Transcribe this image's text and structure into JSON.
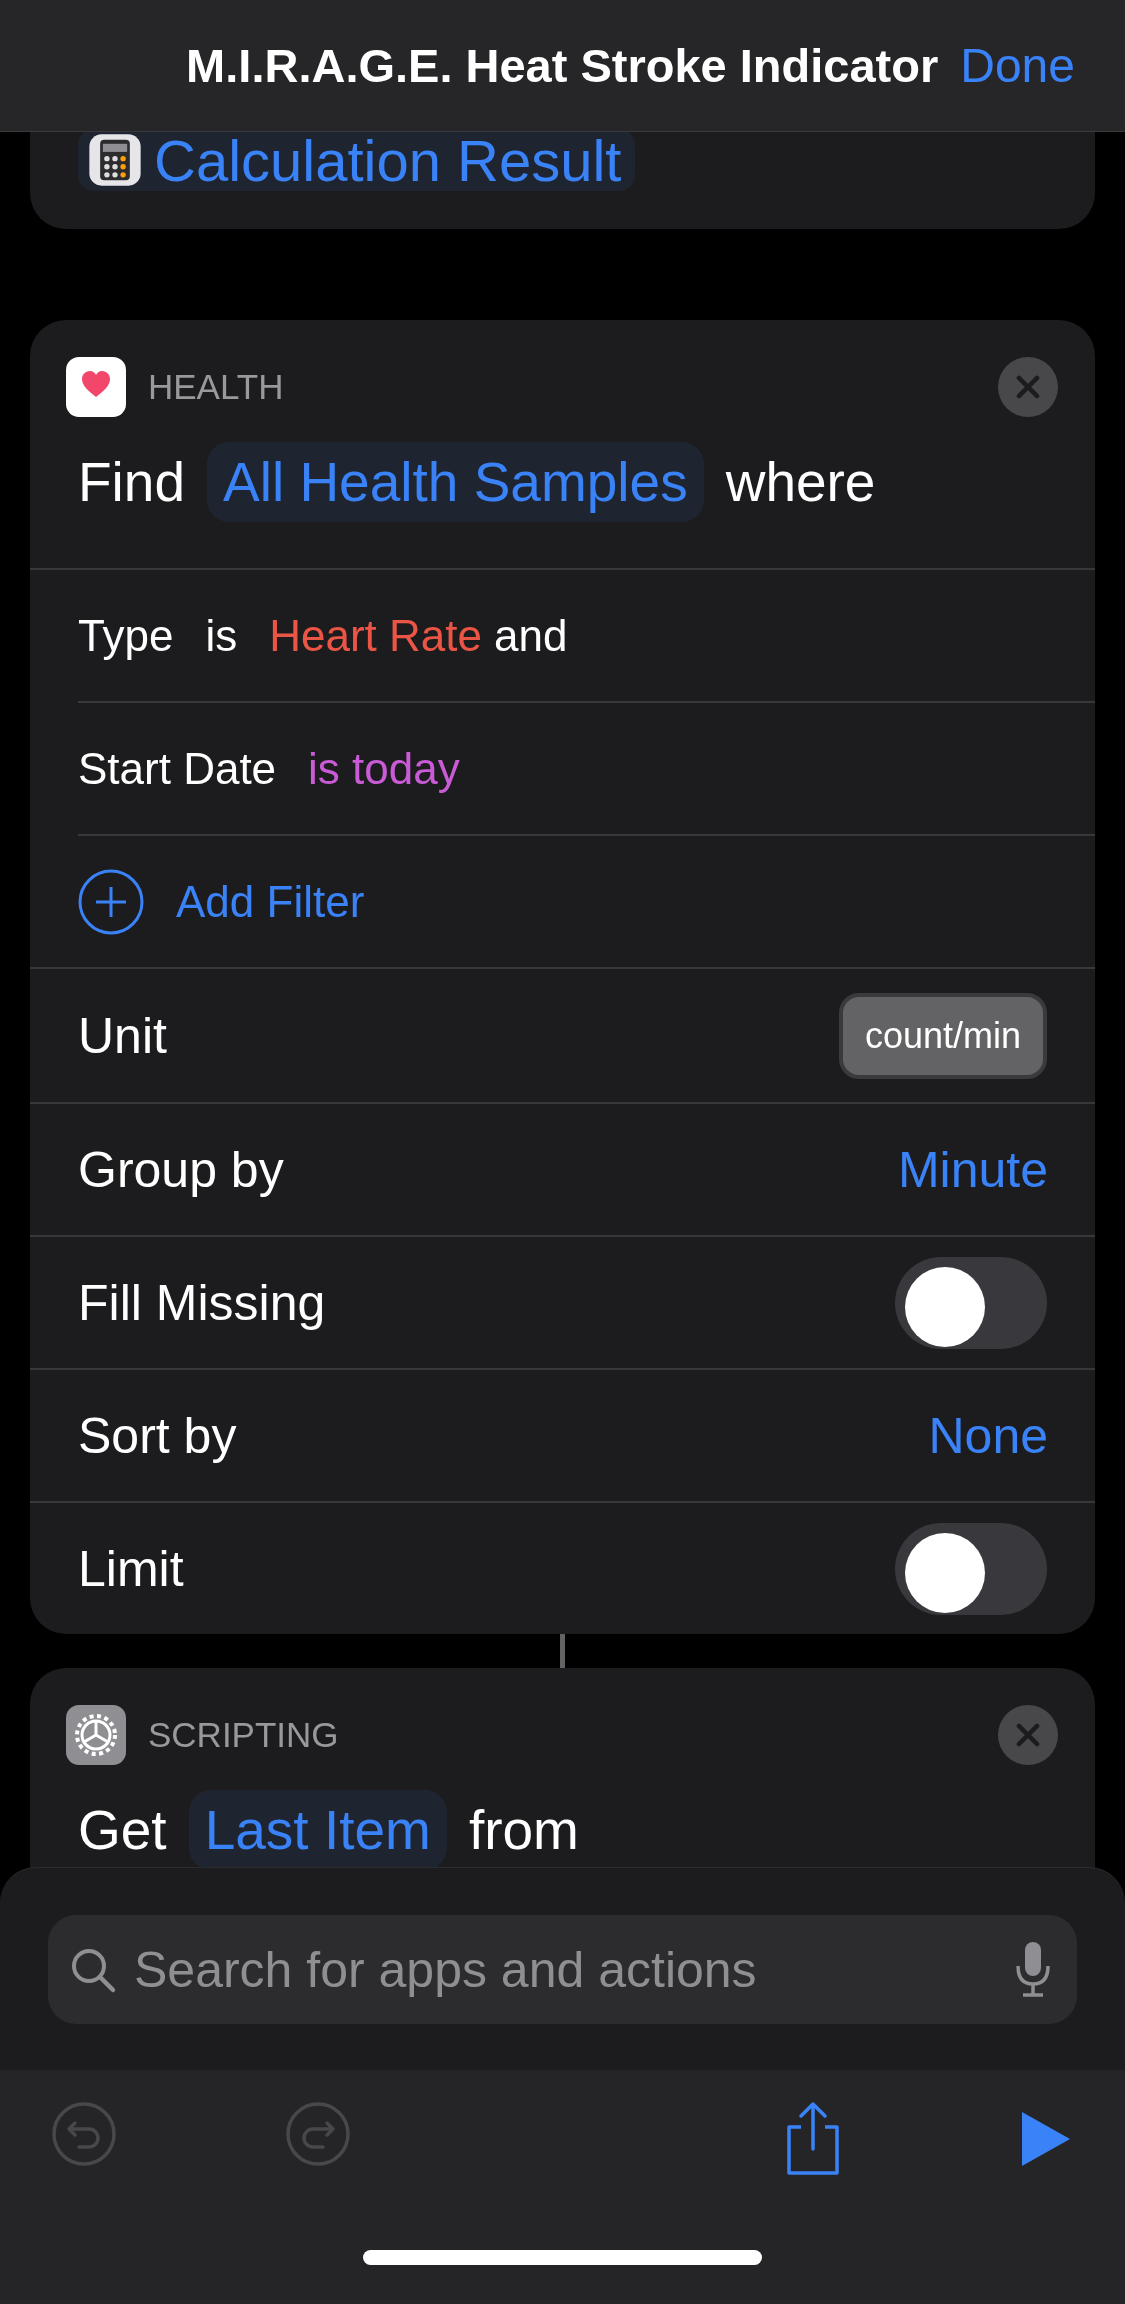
{
  "header": {
    "title": "M.I.R.A.G.E. Heat Stroke Indicator",
    "done": "Done"
  },
  "previous_action": {
    "variable": "Calculation Result"
  },
  "health_action": {
    "category": "HEALTH",
    "verb": "Find",
    "parameter": "All Health Samples",
    "suffix": "where",
    "rows": [
      {
        "kind": "filter",
        "parts": [
          {
            "text": "Type"
          },
          {
            "text": "is"
          },
          {
            "text": "Heart Rate",
            "color": "#eb5545"
          },
          {
            "text": "and"
          }
        ]
      },
      {
        "kind": "filter",
        "parts": [
          {
            "text": "Start Date"
          },
          {
            "text": "is today",
            "color": "#c95bd6"
          }
        ]
      },
      {
        "kind": "add",
        "label": "Add Filter"
      },
      {
        "kind": "chip",
        "label": "Unit",
        "value": "count/min"
      },
      {
        "kind": "link",
        "label": "Group by",
        "value": "Minute"
      },
      {
        "kind": "toggle",
        "label": "Fill Missing",
        "on": false
      },
      {
        "kind": "link",
        "label": "Sort by",
        "value": "None"
      },
      {
        "kind": "toggle",
        "label": "Limit",
        "on": false
      }
    ]
  },
  "scripting_action": {
    "category": "SCRIPTING",
    "verb": "Get",
    "parameter": "Last Item",
    "suffix": "from"
  },
  "search": {
    "placeholder": "Search for apps and actions"
  },
  "toolbar": [
    {
      "kind": "undo",
      "disabled": true
    },
    {
      "kind": "redo",
      "disabled": true
    },
    {
      "kind": "share",
      "disabled": false
    },
    {
      "kind": "run",
      "disabled": false
    }
  ]
}
